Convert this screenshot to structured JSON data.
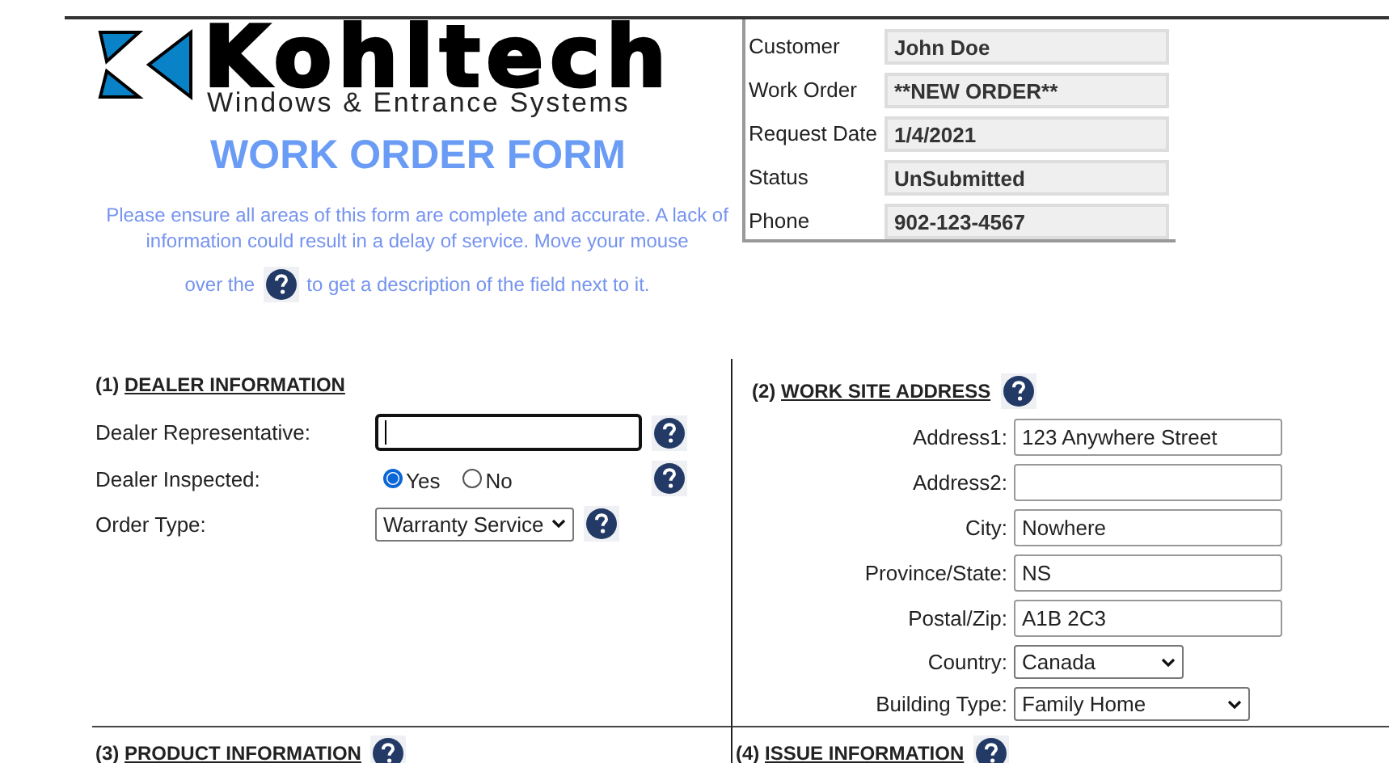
{
  "header": {
    "logo": {
      "name": "Kohltech",
      "tagline": "Windows & Entrance Systems"
    },
    "title": "WORK ORDER FORM",
    "intro": {
      "text": "Please ensure all areas of this form are complete and accurate. A lack of information could result in a delay of service. Move your mouse",
      "before_icon": "over the",
      "after_icon": "to get a description of the field next to it."
    }
  },
  "summary": [
    {
      "label": "Customer",
      "value": "John Doe"
    },
    {
      "label": "Work Order",
      "value": "**NEW ORDER**"
    },
    {
      "label": "Request Date",
      "value": "1/4/2021"
    },
    {
      "label": "Status",
      "value": "UnSubmitted"
    },
    {
      "label": "Phone",
      "value": "902-123-4567"
    }
  ],
  "sections": [
    {
      "number": "(1)",
      "title": "DEALER INFORMATION",
      "help": false,
      "fields": [
        {
          "kind": "text",
          "label": "Dealer Representative:",
          "focused": true,
          "help": true
        },
        {
          "kind": "radio",
          "label": "Dealer Inspected:",
          "options": [
            {
              "label": "Yes",
              "selected": true
            },
            {
              "label": "No",
              "selected": false
            }
          ],
          "help": true
        },
        {
          "kind": "select",
          "label": "Order Type:",
          "value": "Warranty Service",
          "help": true
        }
      ]
    },
    {
      "number": "(2)",
      "title": "WORK SITE ADDRESS",
      "help": true,
      "fields": [
        {
          "kind": "text",
          "label": "Address1:",
          "value": "123 Anywhere Street",
          "focused": false,
          "help": false
        },
        {
          "kind": "text",
          "label": "Address2:",
          "focused": false,
          "help": false
        },
        {
          "kind": "text",
          "label": "City:",
          "value": "Nowhere",
          "focused": false,
          "help": false
        },
        {
          "kind": "text",
          "label": "Province/State:",
          "value": "NS",
          "focused": false,
          "help": false
        },
        {
          "kind": "text",
          "label": "Postal/Zip:",
          "value": "A1B 2C3",
          "focused": false,
          "help": false
        },
        {
          "kind": "select",
          "label": "Country:",
          "value": "Canada",
          "help": false
        },
        {
          "kind": "select",
          "label": "Building Type:",
          "value": "Family Home",
          "help": false
        }
      ]
    },
    {
      "number": "(3)",
      "title": "PRODUCT INFORMATION",
      "help": true
    },
    {
      "number": "(4)",
      "title": "ISSUE INFORMATION",
      "help": true
    }
  ]
}
